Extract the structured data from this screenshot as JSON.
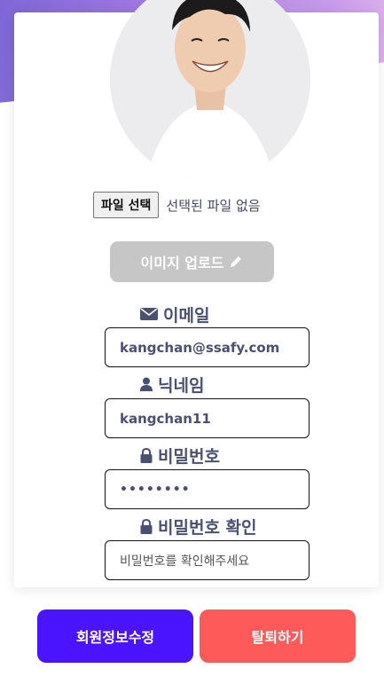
{
  "profile": {
    "file_button_label": "파일 선택",
    "file_status": "선택된 파일 없음",
    "upload_button_label": "이미지 업로드"
  },
  "fields": {
    "email": {
      "label": "이메일",
      "value": "kangchan@ssafy.com",
      "icon": "envelope-icon"
    },
    "nickname": {
      "label": "닉네임",
      "value": "kangchan11",
      "icon": "user-icon"
    },
    "password": {
      "label": "비밀번호",
      "value": "••••••••",
      "icon": "lock-icon"
    },
    "password_confirm": {
      "label": "비밀번호 확인",
      "placeholder": "비밀번호를 확인해주세요",
      "icon": "lock-icon"
    }
  },
  "actions": {
    "edit_label": "회원정보수정",
    "withdraw_label": "탈퇴하기"
  },
  "colors": {
    "primary": "#4a14ff",
    "danger": "#ff5a5a",
    "disabled": "#c6c6c6",
    "text": "#4a5070"
  }
}
